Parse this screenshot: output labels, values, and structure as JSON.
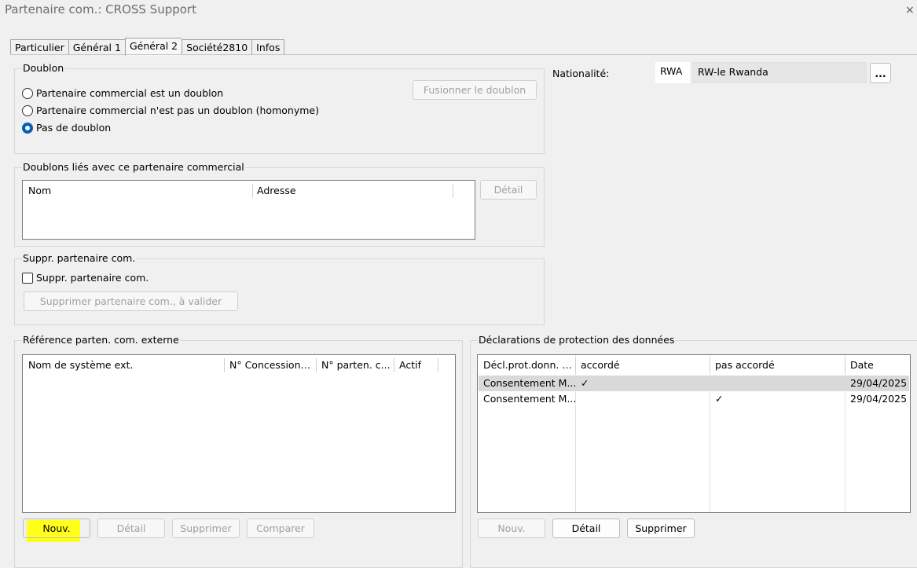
{
  "window": {
    "title": "Partenaire com.: CROSS Support",
    "close_glyph": "×"
  },
  "tabs": [
    {
      "label": "Particulier",
      "active": false
    },
    {
      "label": "Général  1",
      "active": false
    },
    {
      "label": "Général 2",
      "active": true
    },
    {
      "label": "Société2810",
      "active": false
    },
    {
      "label": "Infos",
      "active": false
    }
  ],
  "doublon": {
    "title": "Doublon",
    "options": [
      "Partenaire commercial est un doublon",
      "Partenaire commercial n'est pas un doublon (homonyme)",
      "Pas de doublon"
    ],
    "selected_index": 2,
    "merge_button": "Fusionner le doublon"
  },
  "linked": {
    "title": "Doublons liés avec ce partenaire commercial",
    "columns": [
      "Nom",
      "Adresse"
    ],
    "detail_button": "Détail"
  },
  "suppr": {
    "title": "Suppr. partenaire com.",
    "checkbox_label": "Suppr. partenaire com.",
    "checked": false,
    "button": "Supprimer partenaire com., à valider"
  },
  "nationality": {
    "label": "Nationalité:",
    "code": "RWA",
    "name": "RW-le Rwanda",
    "browse_button": "..."
  },
  "external_ref": {
    "title": "Référence parten. com. externe",
    "columns": [
      "Nom de système ext.",
      "N° Concessionn...",
      "N° parten. c...",
      "Actif"
    ],
    "buttons": {
      "new": "Nouv.",
      "detail": "Détail",
      "delete": "Supprimer",
      "compare": "Comparer"
    }
  },
  "data_protection": {
    "title": "Déclarations de protection des données",
    "columns": [
      "Décl.prot.donn. u...",
      "accordé",
      "pas accordé",
      "Date"
    ],
    "rows": [
      {
        "decl": "Consentement M...",
        "granted": "✓",
        "not_granted": "",
        "date": "29/04/2025",
        "selected": true
      },
      {
        "decl": "Consentement M...",
        "granted": "",
        "not_granted": "✓",
        "date": "29/04/2025",
        "selected": false
      }
    ],
    "buttons": {
      "new": "Nouv.",
      "detail": "Détail",
      "delete": "Supprimer"
    }
  },
  "colors": {
    "highlight": "#ffff1a",
    "radio_selected": "#005fb8",
    "row_selected": "#d9d9d9"
  }
}
